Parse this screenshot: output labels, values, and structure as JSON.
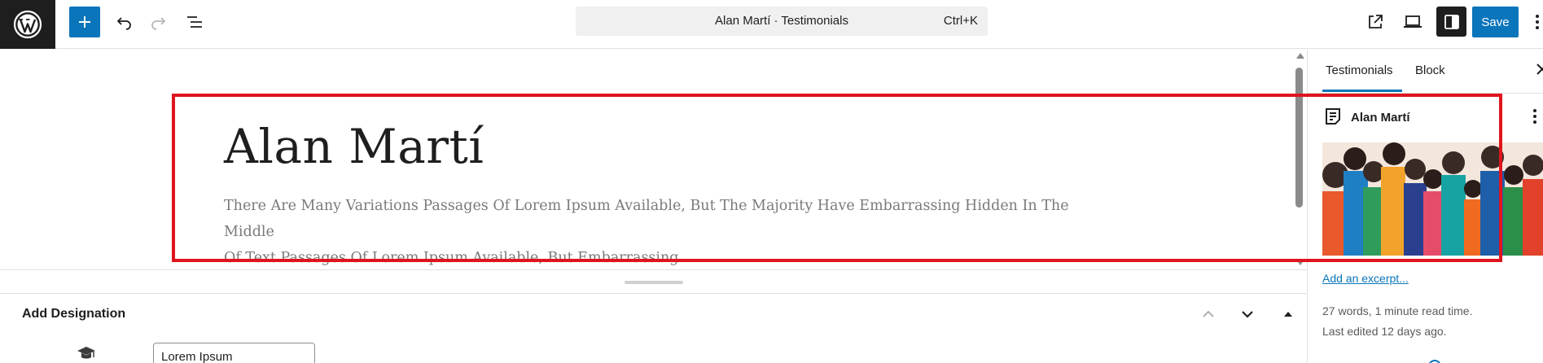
{
  "toolbar": {
    "inserter_icon": "plus-icon",
    "undo_icon": "undo-icon",
    "redo_icon": "redo-icon",
    "list_view_icon": "list-view-icon",
    "command_title": "Alan Martí · Testimonials",
    "command_shortcut": "Ctrl+K",
    "preview_icon": "external-link-icon",
    "device_icon": "laptop-icon",
    "settings_icon": "sidebar-icon",
    "save_label": "Save",
    "accent": "#0a75ba"
  },
  "editor": {
    "title": "Alan Martí",
    "excerpt_lines": [
      "There Are Many Variations Passages Of Lorem Ipsum Available, But The Majority Have Embarrassing Hidden In The Middle",
      "Of Text Passages Of Lorem Ipsum Available, But Embarrassing."
    ],
    "highlight_color": "#e0141e"
  },
  "metabox": {
    "title": "Add Designation",
    "designation_value": "Lorem Ipsum"
  },
  "sidebar": {
    "tabs": [
      {
        "label": "Testimonials",
        "active": true
      },
      {
        "label": "Block",
        "active": false
      }
    ],
    "post_name": "Alan Martí",
    "excerpt_link": "Add an excerpt...",
    "word_count": "27 words, 1 minute read time.",
    "last_edited": "Last edited 12 days ago."
  }
}
